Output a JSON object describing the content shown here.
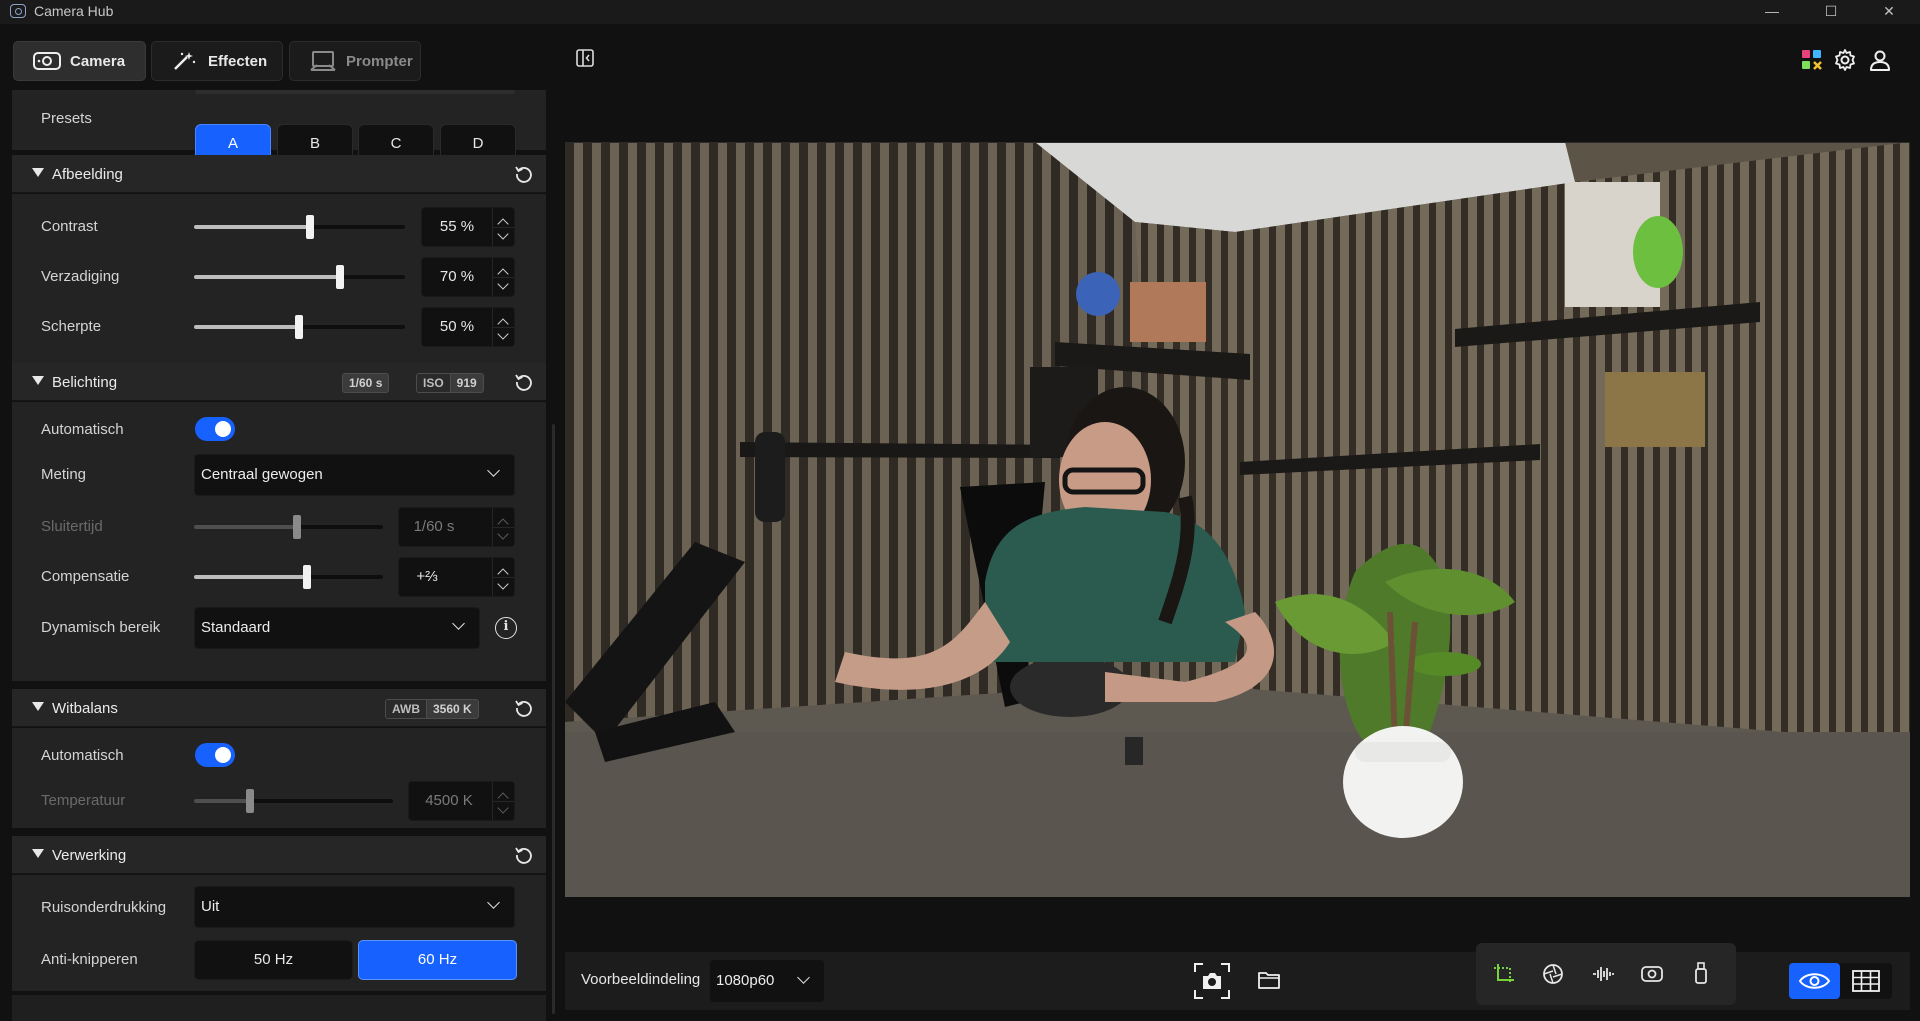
{
  "window": {
    "title": "Camera Hub",
    "minimize": "—",
    "maximize": "☐",
    "close": "✕"
  },
  "tabs": [
    {
      "label": "Camera",
      "icon": "webcam-icon",
      "active": true
    },
    {
      "label": "Effecten",
      "icon": "magic-wand-icon",
      "active": false
    },
    {
      "label": "Prompter",
      "icon": "prompter-icon",
      "active": false
    }
  ],
  "presets": {
    "label": "Presets",
    "options": [
      "A",
      "B",
      "C",
      "D"
    ],
    "selected": "A"
  },
  "afbeelding": {
    "title": "Afbeelding",
    "contrast": {
      "label": "Contrast",
      "value": "55 %",
      "level": 0.55
    },
    "verzadiging": {
      "label": "Verzadiging",
      "value": "70 %",
      "level": 0.7
    },
    "scherpte": {
      "label": "Scherpte",
      "value": "50 %",
      "level": 0.5
    }
  },
  "belichting": {
    "title": "Belichting",
    "shutter_badge": "1/60 s",
    "iso_key": "ISO",
    "iso_value": "919",
    "automatisch": {
      "label": "Automatisch",
      "on": true
    },
    "meting": {
      "label": "Meting",
      "value": "Centraal gewogen"
    },
    "sluitertijd": {
      "label": "Sluitertijd",
      "value": "1/60 s",
      "level": 0.55
    },
    "compensatie": {
      "label": "Compensatie",
      "value": "+⅔",
      "level": 0.6
    },
    "dynamisch_bereik": {
      "label": "Dynamisch bereik",
      "value": "Standaard",
      "info": "i"
    }
  },
  "witbalans": {
    "title": "Witbalans",
    "awb_key": "AWB",
    "awb_value": "3560 K",
    "automatisch": {
      "label": "Automatisch",
      "on": true
    },
    "temperatuur": {
      "label": "Temperatuur",
      "value": "4500 K",
      "level": 0.3
    }
  },
  "verwerking": {
    "title": "Verwerking",
    "ruisonderdrukking": {
      "label": "Ruisonderdrukking",
      "value": "Uit"
    },
    "anti_knipperen": {
      "label": "Anti-knipperen",
      "options": [
        "50 Hz",
        "60 Hz"
      ],
      "selected": "60 Hz"
    }
  },
  "preview_bar": {
    "layout_label": "Voorbeeldindeling",
    "resolution": "1080p60"
  },
  "colors": {
    "accent": "#1762ff",
    "panel": "#232323",
    "background": "#111111"
  }
}
